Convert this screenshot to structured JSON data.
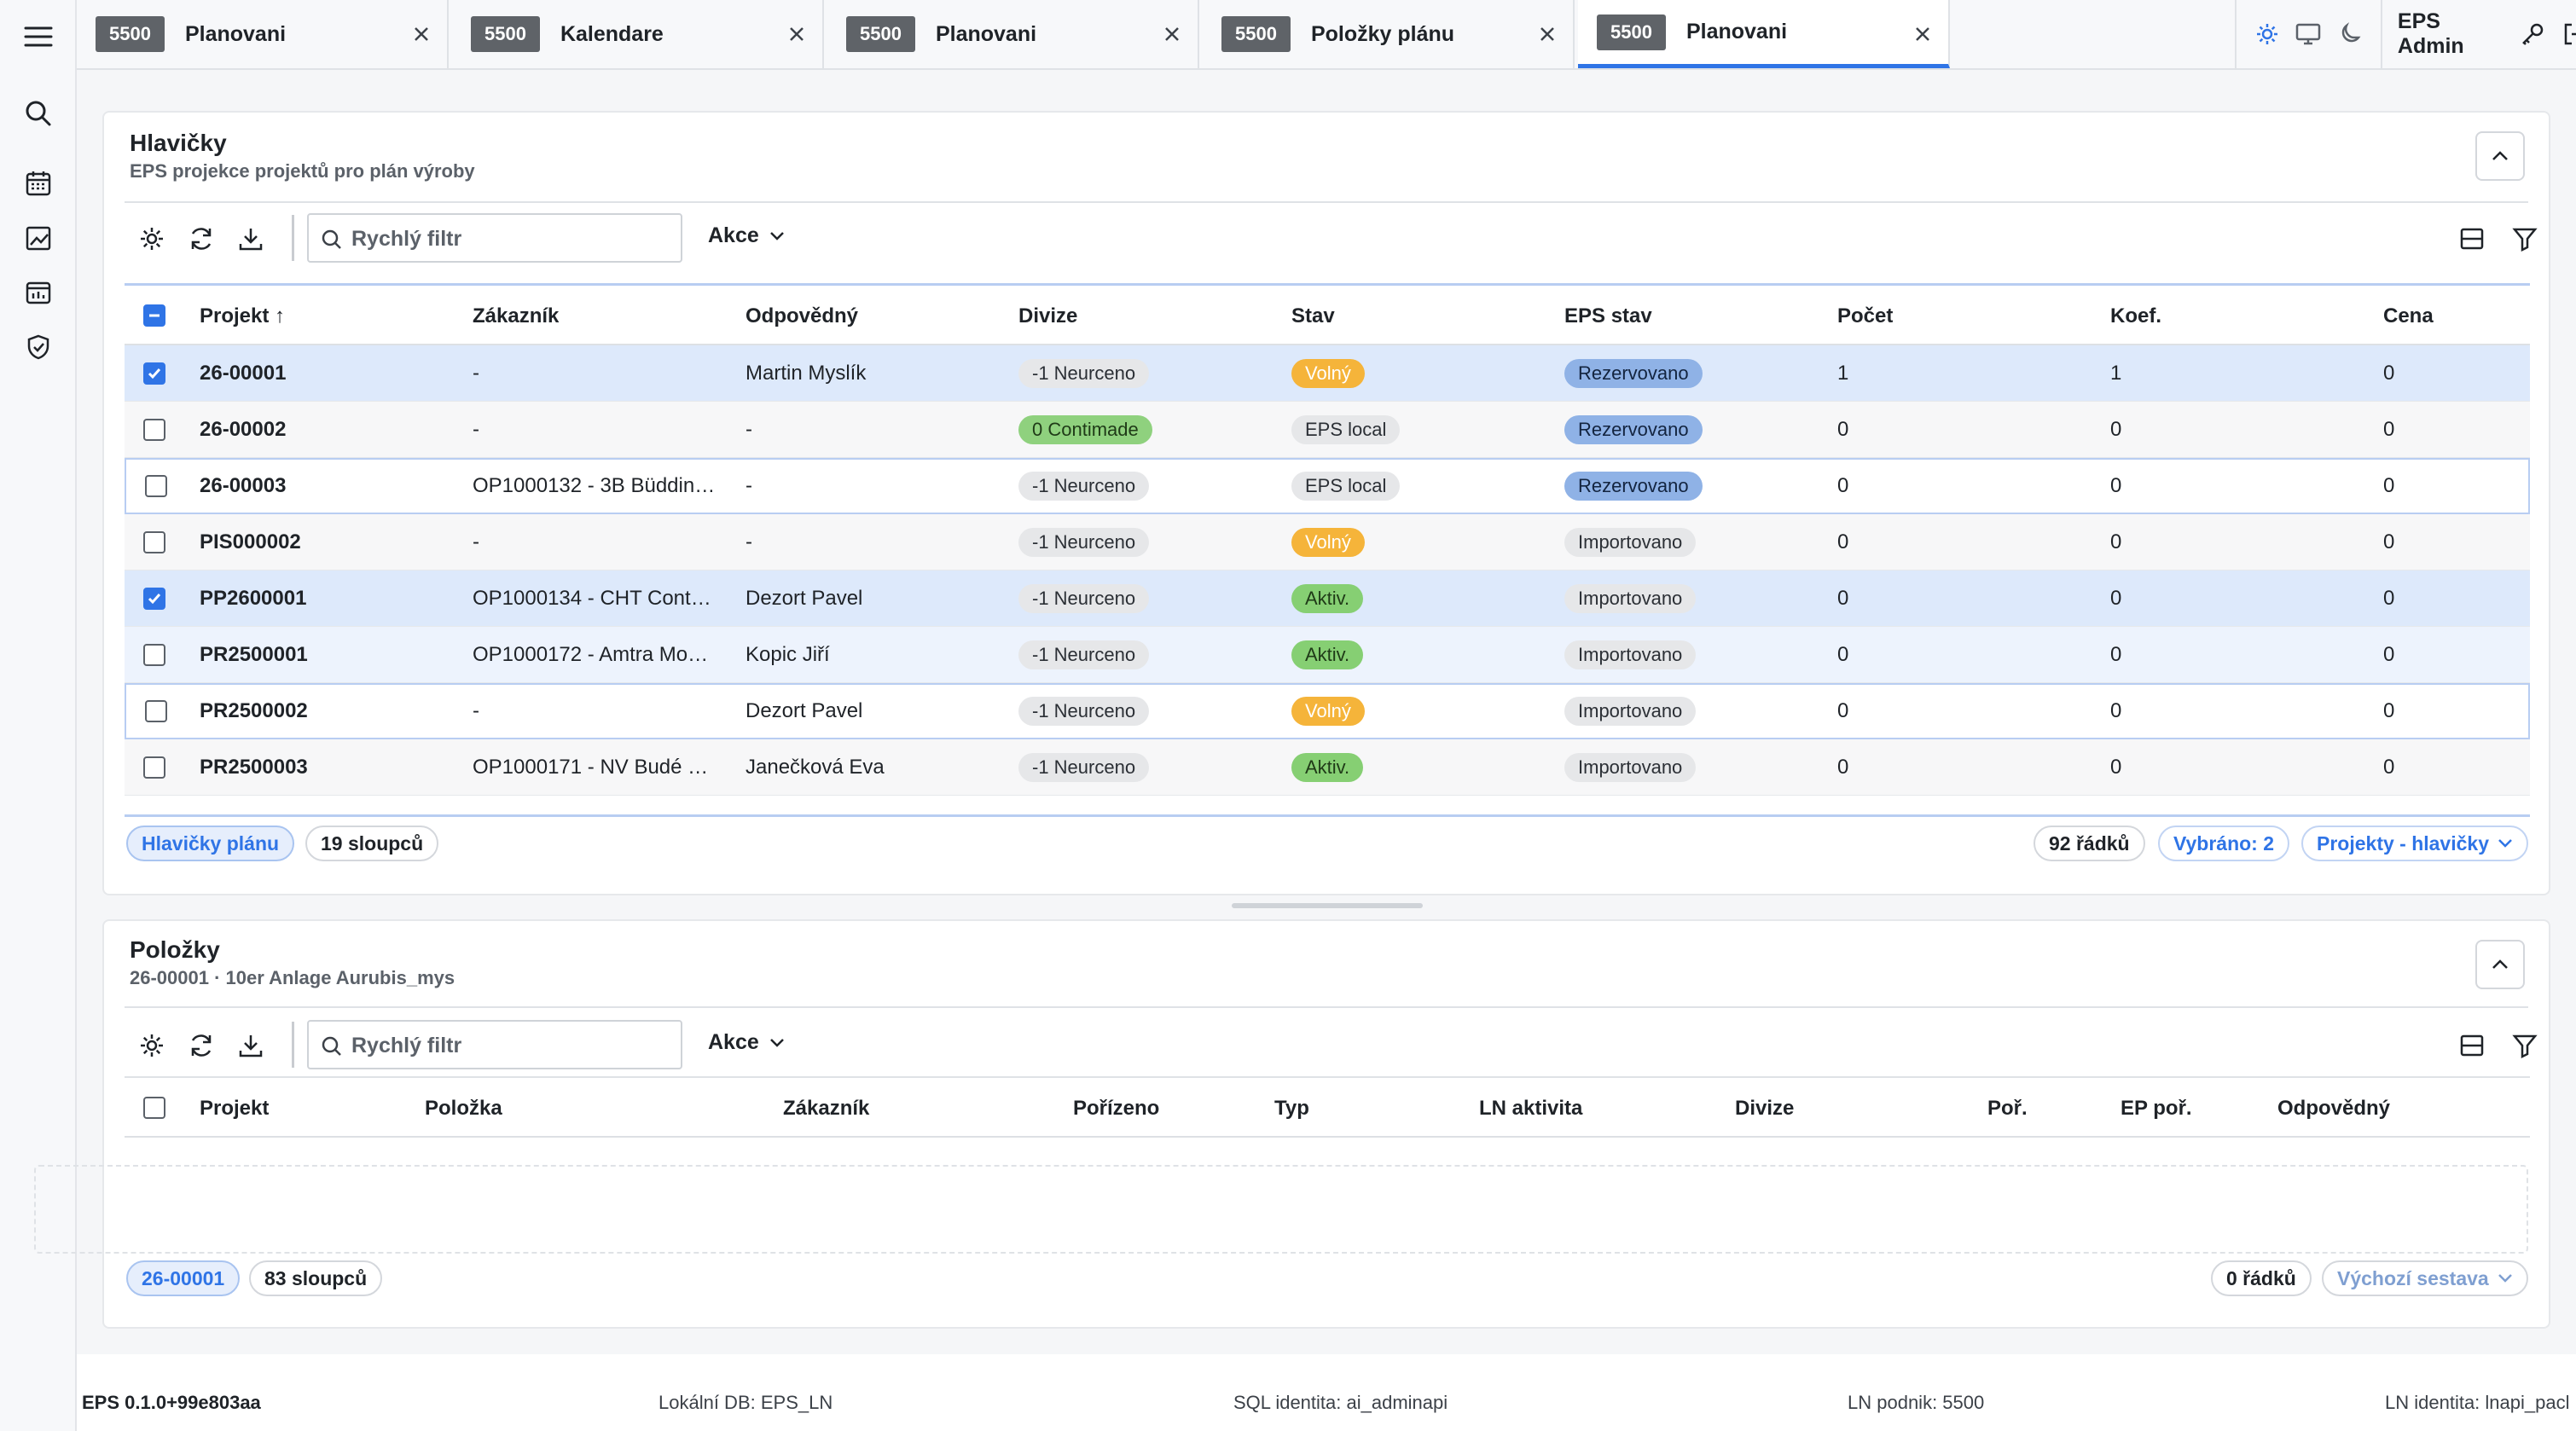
{
  "tabs": [
    {
      "badge": "5500",
      "label": "Planovani",
      "active": false
    },
    {
      "badge": "5500",
      "label": "Kalendare",
      "active": false
    },
    {
      "badge": "5500",
      "label": "Planovani",
      "active": false
    },
    {
      "badge": "5500",
      "label": "Položky plánu",
      "active": false
    },
    {
      "badge": "5500",
      "label": "Planovani",
      "active": true
    }
  ],
  "topbar": {
    "user": "EPS Admin",
    "icons": [
      "sun-icon",
      "monitor-icon",
      "moon-icon",
      "key-icon",
      "logout-icon"
    ]
  },
  "sidebar": {
    "icons": [
      "menu-icon",
      "search-icon",
      "calendar-icon",
      "chart-icon",
      "chart-calendar-icon",
      "shield-icon"
    ]
  },
  "headers_panel": {
    "title": "Hlavičky",
    "subtitle": "EPS projekce projektů pro plán výroby",
    "search_placeholder": "Rychlý filtr",
    "actions_label": "Akce",
    "columns": [
      "Projekt ↑",
      "Zákazník",
      "Odpovědný",
      "Divize",
      "Stav",
      "EPS stav",
      "Počet",
      "Koef.",
      "Cena"
    ],
    "rows": [
      {
        "projekt": "26-00001",
        "zakaznik": "-",
        "odpovedny": "Martin Myslík",
        "divize": "-1 Neurceno",
        "stav": "Volný",
        "eps_stav": "Rezervovano",
        "pocet": "1",
        "koef": "1",
        "cena": "0",
        "checked": true
      },
      {
        "projekt": "26-00002",
        "zakaznik": "-",
        "odpovedny": "-",
        "divize": "0 Contimade",
        "stav": "EPS local",
        "eps_stav": "Rezervovano",
        "pocet": "0",
        "koef": "0",
        "cena": "0",
        "checked": false
      },
      {
        "projekt": "26-00003",
        "zakaznik": "OP1000132 - 3B Büddin…",
        "odpovedny": "-",
        "divize": "-1 Neurceno",
        "stav": "EPS local",
        "eps_stav": "Rezervovano",
        "pocet": "0",
        "koef": "0",
        "cena": "0",
        "checked": false
      },
      {
        "projekt": "PIS000002",
        "zakaznik": "-",
        "odpovedny": "-",
        "divize": "-1 Neurceno",
        "stav": "Volný",
        "eps_stav": "Importovano",
        "pocet": "0",
        "koef": "0",
        "cena": "0",
        "checked": false
      },
      {
        "projekt": "PP2600001",
        "zakaznik": "OP1000134 - CHT Cont…",
        "odpovedny": "Dezort Pavel",
        "divize": "-1 Neurceno",
        "stav": "Aktiv.",
        "eps_stav": "Importovano",
        "pocet": "0",
        "koef": "0",
        "cena": "0",
        "checked": true
      },
      {
        "projekt": "PR2500001",
        "zakaznik": "OP1000172 - Amtra Mo…",
        "odpovedny": "Kopic Jiří",
        "divize": "-1 Neurceno",
        "stav": "Aktiv.",
        "eps_stav": "Importovano",
        "pocet": "0",
        "koef": "0",
        "cena": "0",
        "checked": false
      },
      {
        "projekt": "PR2500002",
        "zakaznik": "-",
        "odpovedny": "Dezort Pavel",
        "divize": "-1 Neurceno",
        "stav": "Volný",
        "eps_stav": "Importovano",
        "pocet": "0",
        "koef": "0",
        "cena": "0",
        "checked": false
      },
      {
        "projekt": "PR2500003",
        "zakaznik": "OP1000171 - NV Budé …",
        "odpovedny": "Janečková Eva",
        "divize": "-1 Neurceno",
        "stav": "Aktiv.",
        "eps_stav": "Importovano",
        "pocet": "0",
        "koef": "0",
        "cena": "0",
        "checked": false
      }
    ],
    "footer": {
      "view_label": "Hlavičky plánu",
      "columns_count": "19 sloupců",
      "rows_count": "92 řádků",
      "selected": "Vybráno: 2",
      "layout": "Projekty - hlavičky"
    }
  },
  "items_panel": {
    "title": "Položky",
    "subtitle": "26-00001 · 10er Anlage Aurubis_mys",
    "search_placeholder": "Rychlý filtr",
    "actions_label": "Akce",
    "columns": [
      "Projekt",
      "Položka",
      "Zákazník",
      "Pořízeno",
      "Typ",
      "LN aktivita",
      "Divize",
      "Poř.",
      "EP poř.",
      "Odpovědný"
    ],
    "footer": {
      "view_label": "26-00001",
      "columns_count": "83 sloupců",
      "rows_count": "0 řádků",
      "layout": "Výchozí sestava"
    }
  },
  "statusbar": {
    "version": "EPS 0.1.0+99e803aa",
    "local_db": "Lokální DB: EPS_LN",
    "sql_identity": "SQL identita: ai_adminapi",
    "ln_company": "LN podnik: 5500",
    "ln_identity": "LN identita: lnapi_pacl"
  },
  "colors": {
    "accent": "#2f74e6",
    "status_free": "#f5b43a",
    "status_active": "#86cf73",
    "eps_reserved": "#8fb2e6"
  }
}
